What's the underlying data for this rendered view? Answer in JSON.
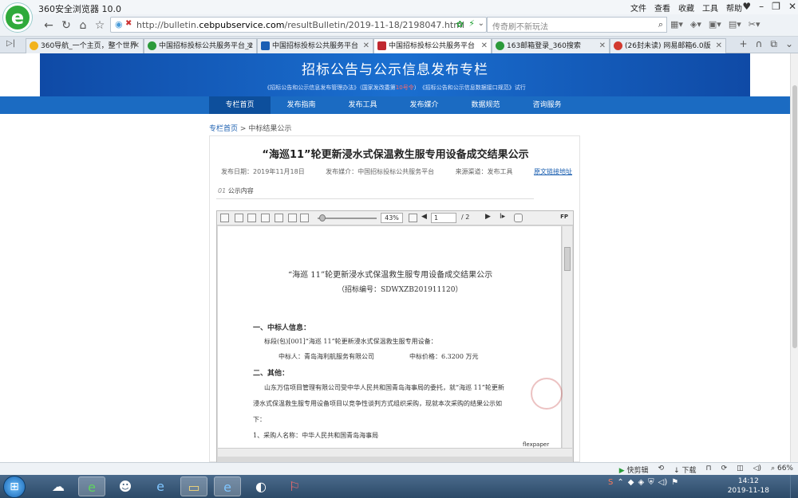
{
  "browser": {
    "app_title": "360安全浏览器 10.0",
    "menu": [
      "文件",
      "查看",
      "收藏",
      "工具",
      "帮助"
    ],
    "address_prefix": "http://bulletin.",
    "address_domain": "cebpubservice.com",
    "address_path": "/resultBulletin/2019-11-18/2198047.html",
    "search_placeholder": "传奇刷不新玩法",
    "tabs": [
      {
        "label": "360导航_一个主页，整个世界",
        "active": false
      },
      {
        "label": "中国招标投标公共服务平台_2",
        "active": false
      },
      {
        "label": "中国招标投标公共服务平台",
        "active": false
      },
      {
        "label": "中国招标投标公共服务平台",
        "active": true
      },
      {
        "label": "163邮箱登录_360搜索",
        "active": false
      },
      {
        "label": "(26封未读) 网易邮箱6.0版",
        "active": false
      }
    ]
  },
  "page": {
    "banner_title": "招标公告与公示信息发布专栏",
    "banner_sub_1": "《招标公告和公示信息发布管理办法》（国家发改委第",
    "banner_sub_red": "10号令",
    "banner_sub_2": "）　《招标公告和公示信息数据接口规范》试行",
    "nav": [
      "专栏首页",
      "发布指南",
      "发布工具",
      "发布媒介",
      "数据规范",
      "咨询服务"
    ],
    "breadcrumb_home": "专栏首页",
    "breadcrumb_sep": ">",
    "breadcrumb_current": "中标结果公示",
    "article": {
      "title": "“海巡11”轮更新浸水式保温救生服专用设备成交结果公示",
      "publish_date": "发布日期：2019年11月18日",
      "publisher": "发布媒介：中国招标投标公共服务平台",
      "source": "来源渠道：发布工具",
      "original_link": "原文链接地址",
      "section_num": "01",
      "section_label": "公示内容"
    },
    "viewer": {
      "zoom": "43%",
      "page_current": "1",
      "page_total": "/ 2",
      "fp_label": "FP",
      "watermark": "flexpaper"
    },
    "pdf": {
      "title": "“海巡 11”轮更新浸水式保温救生服专用设备成交结果公示",
      "bid_no": "（招标编号：SDWXZB201911120）",
      "h1": "一、中标人信息：",
      "lot": "标段(包)[001]“海巡 11”轮更新浸水式保温救生服专用设备：",
      "winner": "中标人：青岛海利航服务有限公司",
      "price": "中标价格：6.3200 万元",
      "h2": "二、其他：",
      "p1": "山东万信项目管理有限公司受中华人民共和国青岛海事局的委托，就“海巡 11”轮更新",
      "p2": "浸水式保温救生服专用设备项目以竞争性谈判方式组织采购，现就本次采购的结果公示如",
      "p3": "下：",
      "item1": "1、采购人名称：中华人民共和国青岛海事局"
    }
  },
  "statusbar": [
    "快剪辑",
    "下载",
    "66%"
  ],
  "taskbar": {
    "time": "14:12",
    "date": "2019-11-18"
  }
}
